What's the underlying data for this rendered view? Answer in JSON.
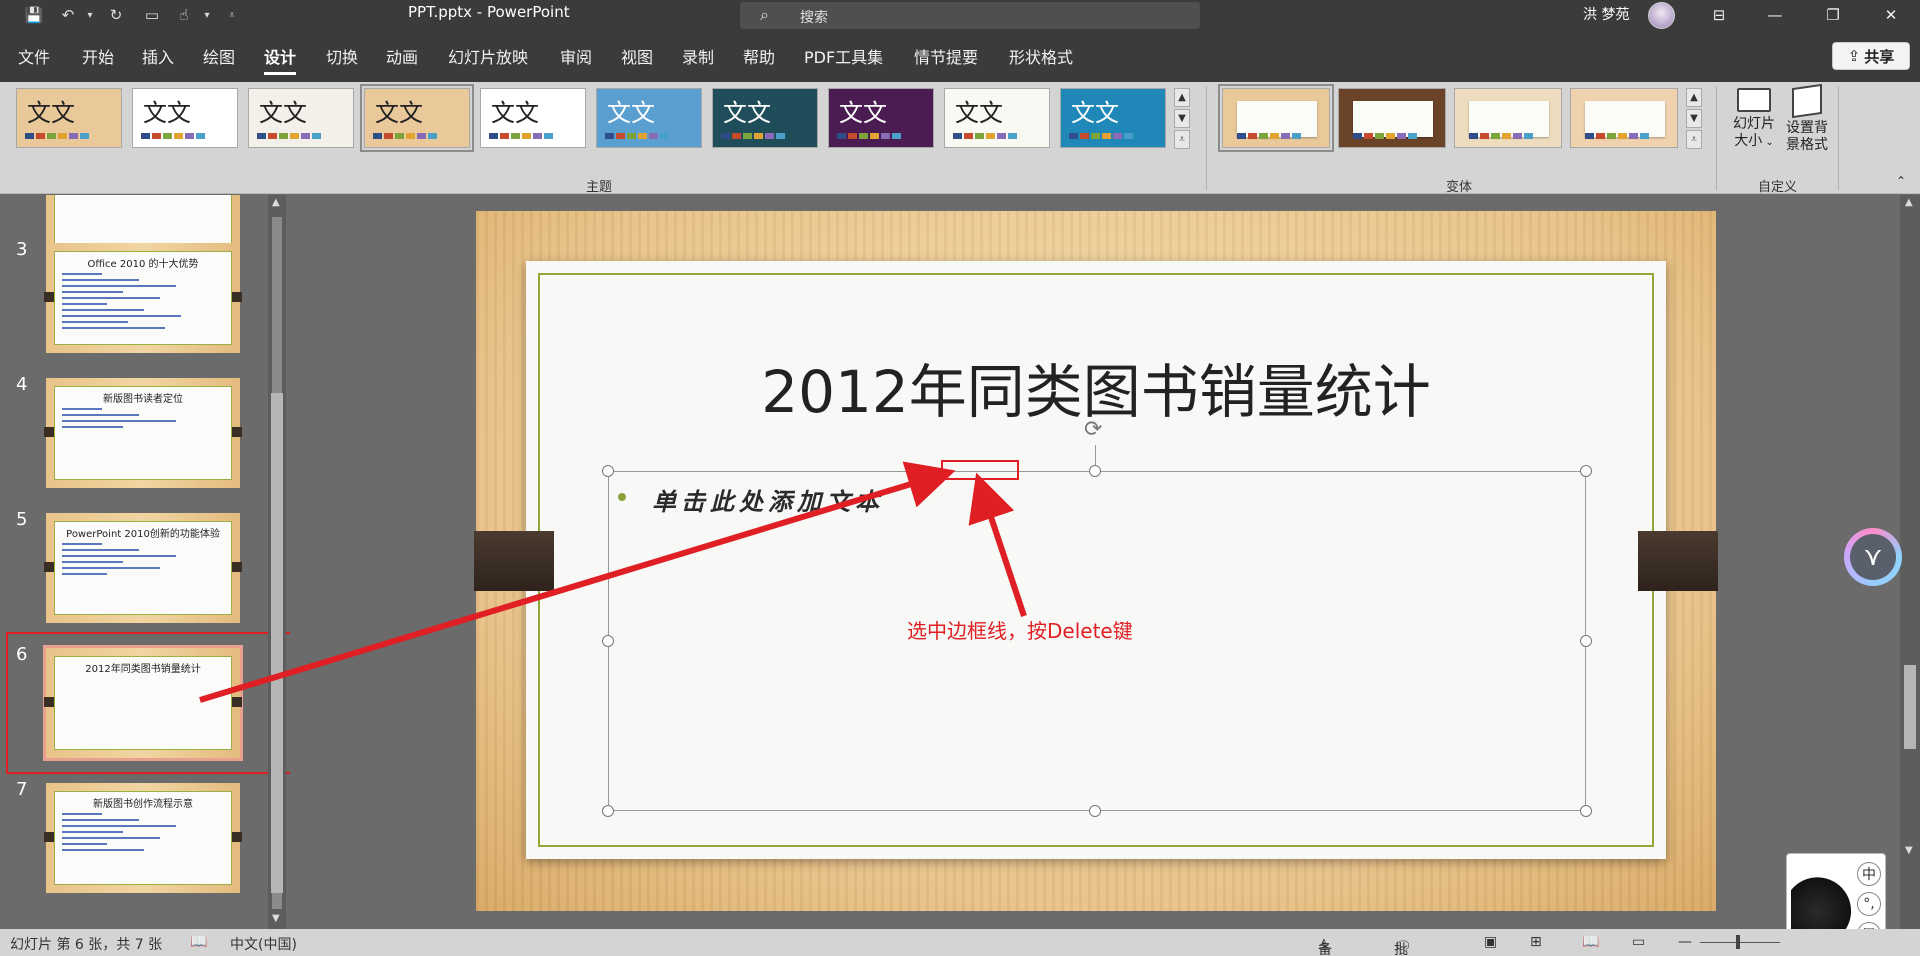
{
  "titlebar": {
    "doc_title": "PPT.pptx  -  PowerPoint",
    "search_placeholder": "搜索",
    "user_name": "洪 梦苑"
  },
  "tabs": [
    "文件",
    "开始",
    "插入",
    "绘图",
    "设计",
    "切换",
    "动画",
    "幻灯片放映",
    "审阅",
    "视图",
    "录制",
    "帮助",
    "PDF工具集",
    "情节提要",
    "形状格式"
  ],
  "active_tab": "设计",
  "share_label": "共享",
  "ribbon": {
    "themes": [
      {
        "text": "文文",
        "bg": "#e9c99a",
        "selected": false
      },
      {
        "text": "文文",
        "bg": "#ffffff",
        "selected": false
      },
      {
        "text": "文文",
        "bg": "#f3efe9",
        "selected": false
      },
      {
        "text": "文文",
        "bg": "#e9c99a",
        "selected": true
      },
      {
        "text": "文文",
        "bg": "#ffffff",
        "selected": false
      },
      {
        "text": "文文",
        "bg": "#5a9fd0",
        "selected": false
      },
      {
        "text": "文文",
        "bg": "#1f4e5a",
        "selected": false
      },
      {
        "text": "文文",
        "bg": "#4a1c52",
        "selected": false
      },
      {
        "text": "文文",
        "bg": "#f7f9f2",
        "selected": false
      },
      {
        "text": "文文",
        "bg": "#1f88b8",
        "selected": false
      }
    ],
    "themes_group_label": "主题",
    "variants": [
      {
        "bg": "#e9c99a",
        "selected": true
      },
      {
        "bg": "#6b4328",
        "selected": false
      },
      {
        "bg": "#eddcbd",
        "selected": false
      },
      {
        "bg": "#f0d2ae",
        "selected": false
      }
    ],
    "variants_group_label": "变体",
    "slide_size_label_1": "幻灯片",
    "slide_size_label_2": "大小",
    "format_bg_label_1": "设置背",
    "format_bg_label_2": "景格式",
    "custom_group_label": "自定义"
  },
  "thumbnails": [
    {
      "num": "3",
      "title": "Office 2010 的十大优势",
      "lines": 10
    },
    {
      "num": "4",
      "title": "新版图书读者定位",
      "lines": 4
    },
    {
      "num": "5",
      "title": "PowerPoint 2010创新的功能体验",
      "lines": 6
    },
    {
      "num": "6",
      "title": "2012年同类图书销量统计",
      "lines": 0
    },
    {
      "num": "7",
      "title": "新版图书创作流程示意",
      "lines": 7
    }
  ],
  "slide": {
    "title": "2012年同类图书销量统计",
    "placeholder": "单击此处添加文本"
  },
  "annotation": "选中边框线，按Delete键",
  "statusbar": {
    "slide_info": "幻灯片 第 6 张，共 7 张",
    "language": "中文(中国)",
    "notes_label": "备注",
    "comments_label": "批注"
  },
  "ime": {
    "key_zhong": "中",
    "key_punct": "°,",
    "key_shirt": "⛉"
  },
  "colors": {
    "accent_red": "#e01f24",
    "slide_frame": "#90a83a",
    "ribbon_bg": "#d4d4d4",
    "titlebar_bg": "#3b3b3b"
  }
}
